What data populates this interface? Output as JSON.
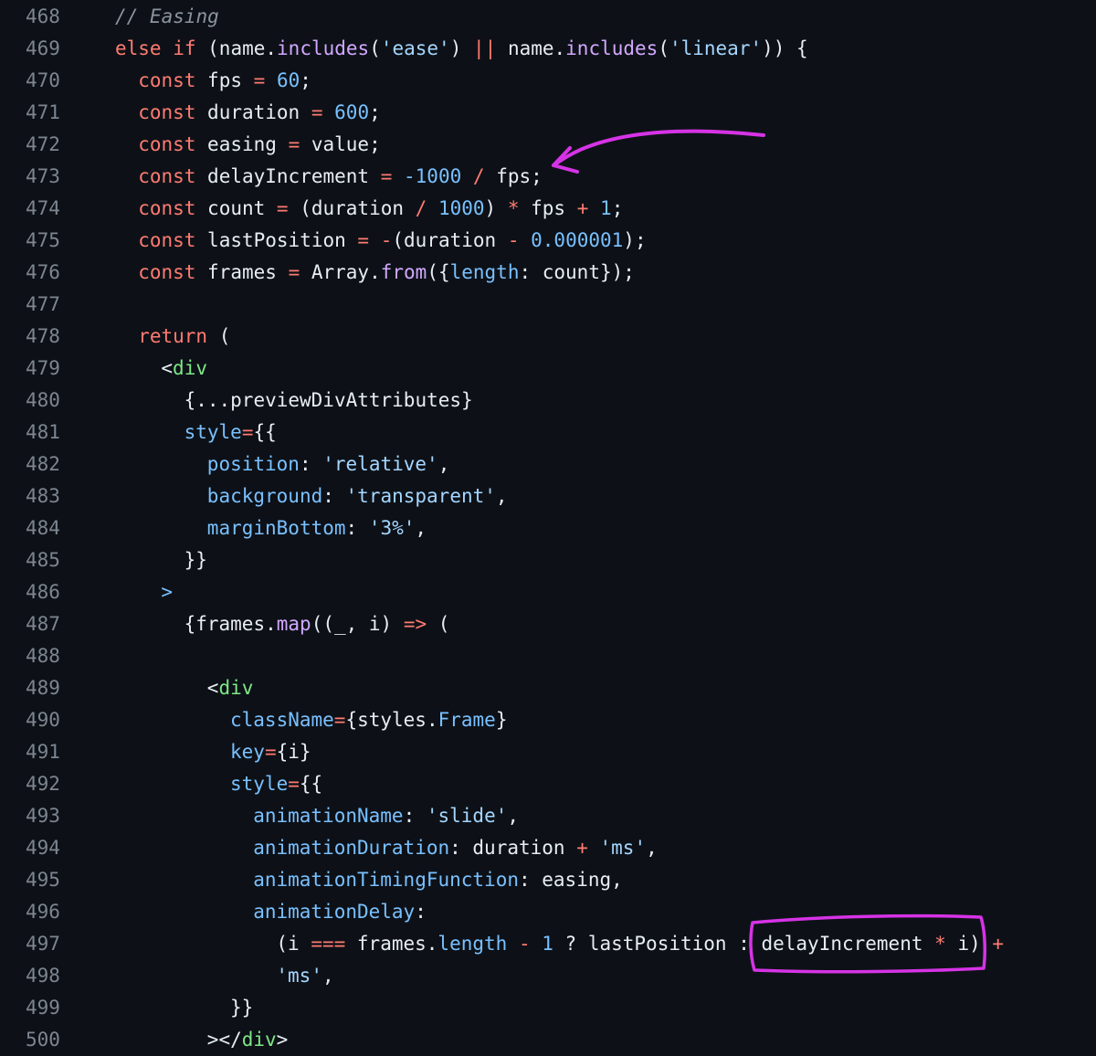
{
  "editor": {
    "annotation_color": "#d633e6",
    "lines": [
      {
        "num": "468",
        "indent": 2,
        "tokens": [
          {
            "t": "// Easing",
            "c": "c"
          }
        ]
      },
      {
        "num": "469",
        "indent": 2,
        "tokens": [
          {
            "t": "else if",
            "c": "k"
          },
          {
            "t": " (name.",
            "c": "p"
          },
          {
            "t": "includes",
            "c": "f"
          },
          {
            "t": "(",
            "c": "p"
          },
          {
            "t": "'ease'",
            "c": "s"
          },
          {
            "t": ") ",
            "c": "p"
          },
          {
            "t": "||",
            "c": "k"
          },
          {
            "t": " name.",
            "c": "p"
          },
          {
            "t": "includes",
            "c": "f"
          },
          {
            "t": "(",
            "c": "p"
          },
          {
            "t": "'linear'",
            "c": "s"
          },
          {
            "t": ")) {",
            "c": "p"
          }
        ]
      },
      {
        "num": "470",
        "indent": 3,
        "tokens": [
          {
            "t": "const",
            "c": "k"
          },
          {
            "t": " fps ",
            "c": "p"
          },
          {
            "t": "=",
            "c": "k"
          },
          {
            "t": " ",
            "c": "p"
          },
          {
            "t": "60",
            "c": "n"
          },
          {
            "t": ";",
            "c": "p"
          }
        ]
      },
      {
        "num": "471",
        "indent": 3,
        "tokens": [
          {
            "t": "const",
            "c": "k"
          },
          {
            "t": " duration ",
            "c": "p"
          },
          {
            "t": "=",
            "c": "k"
          },
          {
            "t": " ",
            "c": "p"
          },
          {
            "t": "600",
            "c": "n"
          },
          {
            "t": ";",
            "c": "p"
          }
        ]
      },
      {
        "num": "472",
        "indent": 3,
        "tokens": [
          {
            "t": "const",
            "c": "k"
          },
          {
            "t": " easing ",
            "c": "p"
          },
          {
            "t": "=",
            "c": "k"
          },
          {
            "t": " value;",
            "c": "p"
          }
        ]
      },
      {
        "num": "473",
        "indent": 3,
        "tokens": [
          {
            "t": "const",
            "c": "k"
          },
          {
            "t": " delayIncrement ",
            "c": "p"
          },
          {
            "t": "=",
            "c": "k"
          },
          {
            "t": " ",
            "c": "p"
          },
          {
            "t": "-1000",
            "c": "n"
          },
          {
            "t": " ",
            "c": "p"
          },
          {
            "t": "/",
            "c": "k"
          },
          {
            "t": " fps;",
            "c": "p"
          }
        ]
      },
      {
        "num": "474",
        "indent": 3,
        "tokens": [
          {
            "t": "const",
            "c": "k"
          },
          {
            "t": " count ",
            "c": "p"
          },
          {
            "t": "=",
            "c": "k"
          },
          {
            "t": " (duration ",
            "c": "p"
          },
          {
            "t": "/",
            "c": "k"
          },
          {
            "t": " ",
            "c": "p"
          },
          {
            "t": "1000",
            "c": "n"
          },
          {
            "t": ") ",
            "c": "p"
          },
          {
            "t": "*",
            "c": "k"
          },
          {
            "t": " fps ",
            "c": "p"
          },
          {
            "t": "+",
            "c": "k"
          },
          {
            "t": " ",
            "c": "p"
          },
          {
            "t": "1",
            "c": "n"
          },
          {
            "t": ";",
            "c": "p"
          }
        ]
      },
      {
        "num": "475",
        "indent": 3,
        "tokens": [
          {
            "t": "const",
            "c": "k"
          },
          {
            "t": " lastPosition ",
            "c": "p"
          },
          {
            "t": "=",
            "c": "k"
          },
          {
            "t": " ",
            "c": "p"
          },
          {
            "t": "-",
            "c": "k"
          },
          {
            "t": "(duration ",
            "c": "p"
          },
          {
            "t": "-",
            "c": "k"
          },
          {
            "t": " ",
            "c": "p"
          },
          {
            "t": "0.000001",
            "c": "n"
          },
          {
            "t": ");",
            "c": "p"
          }
        ]
      },
      {
        "num": "476",
        "indent": 3,
        "tokens": [
          {
            "t": "const",
            "c": "k"
          },
          {
            "t": " frames ",
            "c": "p"
          },
          {
            "t": "=",
            "c": "k"
          },
          {
            "t": " Array.",
            "c": "p"
          },
          {
            "t": "from",
            "c": "f"
          },
          {
            "t": "({",
            "c": "p"
          },
          {
            "t": "length",
            "c": "n"
          },
          {
            "t": ": count});",
            "c": "p"
          }
        ]
      },
      {
        "num": "477",
        "indent": 0,
        "tokens": []
      },
      {
        "num": "478",
        "indent": 3,
        "tokens": [
          {
            "t": "return",
            "c": "k"
          },
          {
            "t": " (",
            "c": "p"
          }
        ]
      },
      {
        "num": "479",
        "indent": 4,
        "tokens": [
          {
            "t": "<",
            "c": "p"
          },
          {
            "t": "div",
            "c": "t"
          }
        ]
      },
      {
        "num": "480",
        "indent": 5,
        "tokens": [
          {
            "t": "{...previewDivAttributes}",
            "c": "p"
          }
        ]
      },
      {
        "num": "481",
        "indent": 5,
        "tokens": [
          {
            "t": "style",
            "c": "n"
          },
          {
            "t": "=",
            "c": "k"
          },
          {
            "t": "{{",
            "c": "p"
          }
        ]
      },
      {
        "num": "482",
        "indent": 6,
        "tokens": [
          {
            "t": "position",
            "c": "n"
          },
          {
            "t": ": ",
            "c": "p"
          },
          {
            "t": "'relative'",
            "c": "s"
          },
          {
            "t": ",",
            "c": "p"
          }
        ]
      },
      {
        "num": "483",
        "indent": 6,
        "tokens": [
          {
            "t": "background",
            "c": "n"
          },
          {
            "t": ": ",
            "c": "p"
          },
          {
            "t": "'transparent'",
            "c": "s"
          },
          {
            "t": ",",
            "c": "p"
          }
        ]
      },
      {
        "num": "484",
        "indent": 6,
        "tokens": [
          {
            "t": "marginBottom",
            "c": "n"
          },
          {
            "t": ": ",
            "c": "p"
          },
          {
            "t": "'3%'",
            "c": "s"
          },
          {
            "t": ",",
            "c": "p"
          }
        ]
      },
      {
        "num": "485",
        "indent": 5,
        "tokens": [
          {
            "t": "}}",
            "c": "p"
          }
        ]
      },
      {
        "num": "486",
        "indent": 4,
        "tokens": [
          {
            "t": ">",
            "c": "n"
          }
        ]
      },
      {
        "num": "487",
        "indent": 5,
        "tokens": [
          {
            "t": "{frames.",
            "c": "p"
          },
          {
            "t": "map",
            "c": "f"
          },
          {
            "t": "((_, i) ",
            "c": "p"
          },
          {
            "t": "=>",
            "c": "k"
          },
          {
            "t": " (",
            "c": "p"
          }
        ]
      },
      {
        "num": "488",
        "indent": 0,
        "tokens": []
      },
      {
        "num": "489",
        "indent": 6,
        "tokens": [
          {
            "t": "<",
            "c": "p"
          },
          {
            "t": "div",
            "c": "t"
          }
        ]
      },
      {
        "num": "490",
        "indent": 7,
        "tokens": [
          {
            "t": "className",
            "c": "n"
          },
          {
            "t": "=",
            "c": "k"
          },
          {
            "t": "{styles.",
            "c": "p"
          },
          {
            "t": "Frame",
            "c": "n"
          },
          {
            "t": "}",
            "c": "p"
          }
        ]
      },
      {
        "num": "491",
        "indent": 7,
        "tokens": [
          {
            "t": "key",
            "c": "n"
          },
          {
            "t": "=",
            "c": "k"
          },
          {
            "t": "{i}",
            "c": "p"
          }
        ]
      },
      {
        "num": "492",
        "indent": 7,
        "tokens": [
          {
            "t": "style",
            "c": "n"
          },
          {
            "t": "=",
            "c": "k"
          },
          {
            "t": "{{",
            "c": "p"
          }
        ]
      },
      {
        "num": "493",
        "indent": 8,
        "tokens": [
          {
            "t": "animationName",
            "c": "n"
          },
          {
            "t": ": ",
            "c": "p"
          },
          {
            "t": "'slide'",
            "c": "s"
          },
          {
            "t": ",",
            "c": "p"
          }
        ]
      },
      {
        "num": "494",
        "indent": 8,
        "tokens": [
          {
            "t": "animationDuration",
            "c": "n"
          },
          {
            "t": ": duration ",
            "c": "p"
          },
          {
            "t": "+",
            "c": "k"
          },
          {
            "t": " ",
            "c": "p"
          },
          {
            "t": "'ms'",
            "c": "s"
          },
          {
            "t": ",",
            "c": "p"
          }
        ]
      },
      {
        "num": "495",
        "indent": 8,
        "tokens": [
          {
            "t": "animationTimingFunction",
            "c": "n"
          },
          {
            "t": ": easing,",
            "c": "p"
          }
        ]
      },
      {
        "num": "496",
        "indent": 8,
        "tokens": [
          {
            "t": "animationDelay",
            "c": "n"
          },
          {
            "t": ":",
            "c": "p"
          }
        ]
      },
      {
        "num": "497",
        "indent": 9,
        "tokens": [
          {
            "t": "(i ",
            "c": "p"
          },
          {
            "t": "===",
            "c": "k"
          },
          {
            "t": " frames.",
            "c": "p"
          },
          {
            "t": "length",
            "c": "n"
          },
          {
            "t": " ",
            "c": "p"
          },
          {
            "t": "-",
            "c": "k"
          },
          {
            "t": " ",
            "c": "p"
          },
          {
            "t": "1",
            "c": "n"
          },
          {
            "t": " ? lastPosition : delayIncrement ",
            "c": "p"
          },
          {
            "t": "*",
            "c": "k"
          },
          {
            "t": " i) ",
            "c": "p"
          },
          {
            "t": "+",
            "c": "k"
          }
        ]
      },
      {
        "num": "498",
        "indent": 9,
        "tokens": [
          {
            "t": "'ms'",
            "c": "s"
          },
          {
            "t": ",",
            "c": "p"
          }
        ]
      },
      {
        "num": "499",
        "indent": 7,
        "tokens": [
          {
            "t": "}}",
            "c": "p"
          }
        ]
      },
      {
        "num": "500",
        "indent": 6,
        "tokens": [
          {
            "t": "></",
            "c": "p"
          },
          {
            "t": "div",
            "c": "t"
          },
          {
            "t": ">",
            "c": "p"
          }
        ]
      }
    ]
  }
}
